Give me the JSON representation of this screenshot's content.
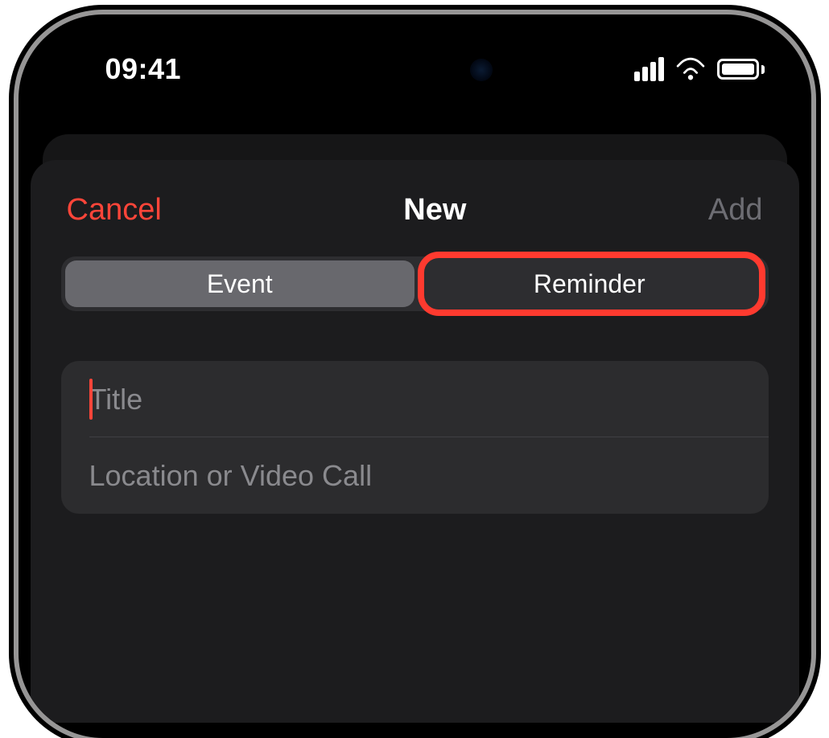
{
  "status": {
    "time": "09:41"
  },
  "modal": {
    "cancel": "Cancel",
    "title": "New",
    "add": "Add",
    "segments": {
      "event": "Event",
      "reminder": "Reminder"
    },
    "fields": {
      "title_placeholder": "Title",
      "location_placeholder": "Location or Video Call"
    }
  }
}
